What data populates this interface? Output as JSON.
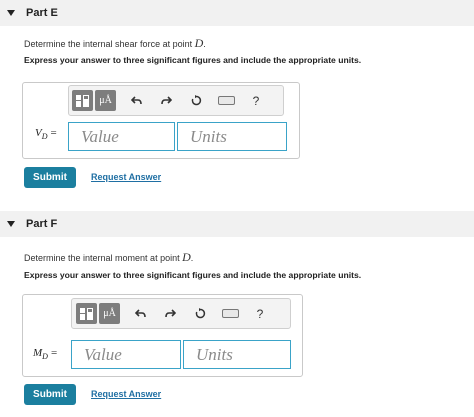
{
  "partE": {
    "title": "Part E",
    "question_prefix": "Determine the internal shear force at point ",
    "question_var": "D",
    "question_suffix": ".",
    "instruction": "Express your answer to three significant figures and include the appropriate units.",
    "var_main": "V",
    "var_sub": "D",
    "equals": "=",
    "value_placeholder": "Value",
    "units_placeholder": "Units",
    "submit_label": "Submit",
    "request_label": "Request Answer"
  },
  "partF": {
    "title": "Part F",
    "question_prefix": "Determine the internal moment at point ",
    "question_var": "D",
    "question_suffix": ".",
    "instruction": "Express your answer to three significant figures and include the appropriate units.",
    "var_main": "M",
    "var_sub": "D",
    "equals": "=",
    "value_placeholder": "Value",
    "units_placeholder": "Units",
    "submit_label": "Submit",
    "request_label": "Request Answer"
  },
  "toolbar": {
    "units_symbol": "μÅ",
    "help_symbol": "?",
    "icons": [
      "templates-icon",
      "units-icon",
      "undo-icon",
      "redo-icon",
      "reset-icon",
      "keyboard-icon",
      "help-icon"
    ]
  }
}
